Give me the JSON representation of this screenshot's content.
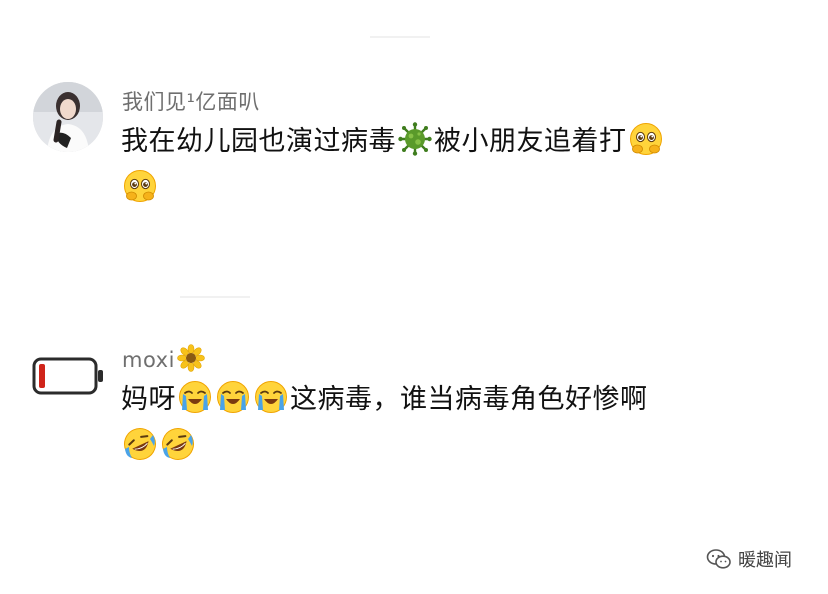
{
  "comments": [
    {
      "username": "我们见¹亿面叭",
      "text_parts": [
        "我在幼儿园也演过病毒",
        "被小朋友追着打"
      ],
      "avatar_icon": "user-photo-avatar",
      "emojis": [
        "virus-icon",
        "pleading-face-emoji",
        "pleading-face-emoji"
      ]
    },
    {
      "username": "moxi",
      "text_parts": [
        "妈呀",
        "这病毒，谁当病毒角色好惨啊"
      ],
      "avatar_icon": "low-battery-icon",
      "emojis": [
        "sunflower-icon",
        "crying-face-emoji",
        "crying-face-emoji",
        "crying-face-emoji",
        "rolling-laughing-emoji",
        "rolling-laughing-emoji"
      ]
    }
  ],
  "watermark": {
    "text": "暖趣闻",
    "icon": "wechat-official-account-icon"
  },
  "colors": {
    "username": "#6f6f6f",
    "text": "#111111",
    "background": "#ffffff",
    "battery": "#d0241a"
  }
}
